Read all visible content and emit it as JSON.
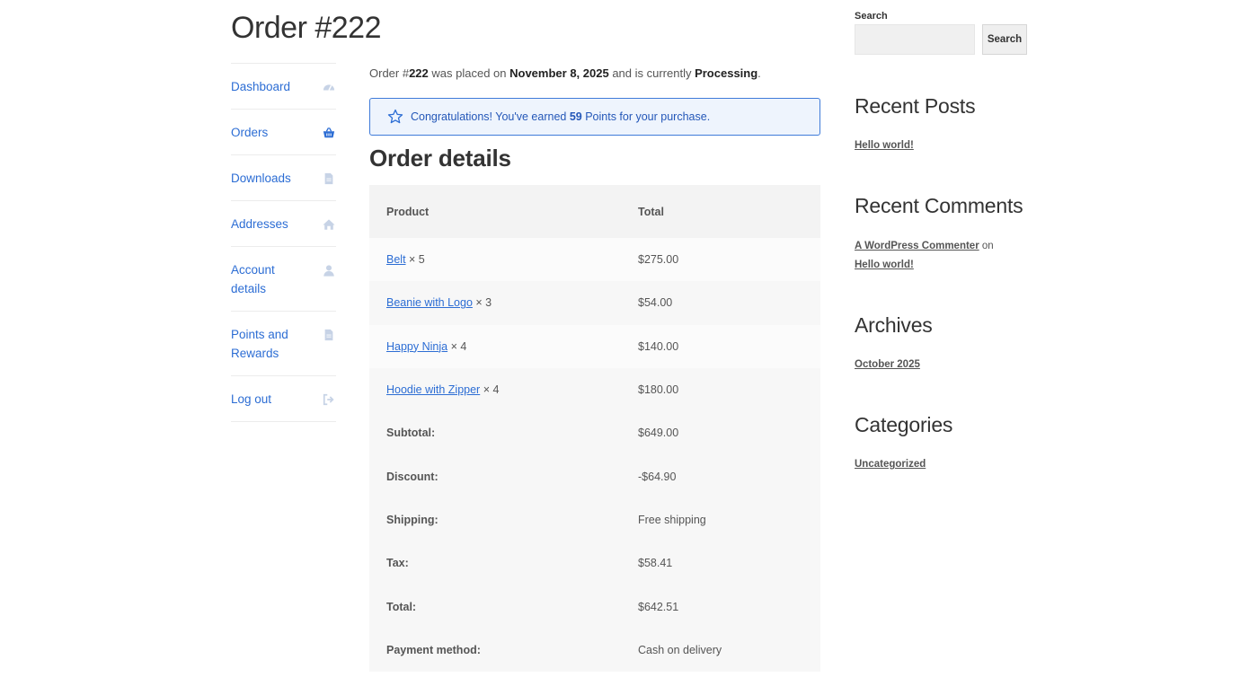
{
  "page": {
    "title": "Order #222"
  },
  "nav": {
    "items": [
      {
        "label": "Dashboard",
        "icon": "dashboard-gauge-icon"
      },
      {
        "label": "Orders",
        "icon": "basket-icon"
      },
      {
        "label": "Downloads",
        "icon": "file-icon"
      },
      {
        "label": "Addresses",
        "icon": "home-icon"
      },
      {
        "label": "Account details",
        "icon": "user-icon"
      },
      {
        "label": "Points and Rewards",
        "icon": "file-icon"
      },
      {
        "label": "Log out",
        "icon": "sign-out-icon"
      }
    ],
    "active": "Orders"
  },
  "order": {
    "prefix": "Order #",
    "number": "222",
    "placed_text": " was placed on ",
    "date": "November 8, 2025",
    "status_text": " and is currently ",
    "status": "Processing",
    "end": "."
  },
  "notice": {
    "prefix": "Congratulations! You've earned ",
    "points": "59",
    "suffix": " Points for your purchase."
  },
  "details": {
    "title": "Order details",
    "col_product": "Product",
    "col_total": "Total",
    "items": [
      {
        "name": "Belt",
        "qty": "× 5",
        "total": "$275.00"
      },
      {
        "name": "Beanie with Logo",
        "qty": "× 3",
        "total": "$54.00"
      },
      {
        "name": "Happy Ninja",
        "qty": "× 4",
        "total": "$140.00"
      },
      {
        "name": "Hoodie with Zipper",
        "qty": "× 4",
        "total": "$180.00"
      }
    ],
    "totals": [
      {
        "label": "Subtotal:",
        "value": "$649.00"
      },
      {
        "label": "Discount:",
        "value": "-$64.90"
      },
      {
        "label": "Shipping:",
        "value": "Free shipping"
      },
      {
        "label": "Tax:",
        "value": "$58.41"
      },
      {
        "label": "Total:",
        "value": "$642.51"
      },
      {
        "label": "Payment method:",
        "value": "Cash on delivery"
      }
    ]
  },
  "sidebar": {
    "search_label": "Search",
    "search_value": "",
    "search_button": "Search",
    "recent_posts_title": "Recent Posts",
    "recent_post": "Hello world!",
    "recent_comments_title": "Recent Comments",
    "comment_author": "A WordPress Commenter",
    "comment_on": " on ",
    "comment_post": "Hello world!",
    "archives_title": "Archives",
    "archive_item": "October 2025",
    "categories_title": "Categories",
    "category_item": "Uncategorized"
  },
  "colors": {
    "link": "#2c6dd4",
    "notice_border": "#3f7bd9",
    "notice_bg": "#eef4fd"
  }
}
